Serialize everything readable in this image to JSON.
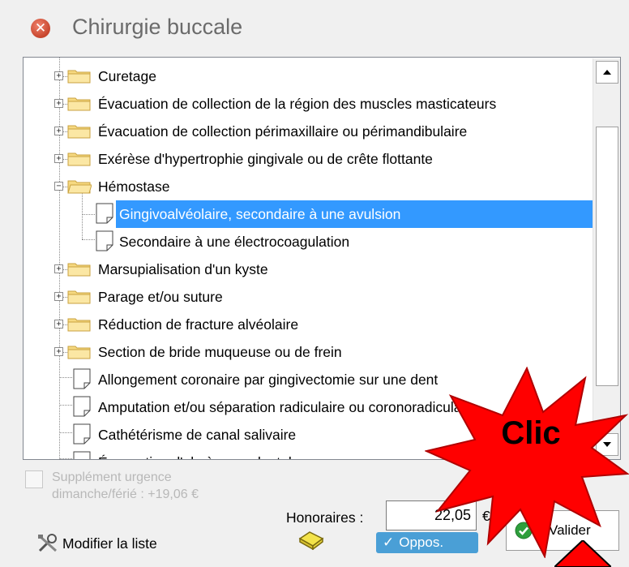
{
  "window": {
    "title": "Chirurgie buccale"
  },
  "tree": {
    "items": [
      {
        "label": "Curetage",
        "type": "folder",
        "expanded": false
      },
      {
        "label": "Évacuation de collection de la région des muscles masticateurs",
        "type": "folder",
        "expanded": false
      },
      {
        "label": "Évacuation de collection périmaxillaire ou périmandibulaire",
        "type": "folder",
        "expanded": false
      },
      {
        "label": "Exérèse d'hypertrophie gingivale ou de crête flottante",
        "type": "folder",
        "expanded": false
      },
      {
        "label": "Hémostase",
        "type": "folder",
        "expanded": true
      },
      {
        "label": "Gingivoalvéolaire, secondaire à une avulsion",
        "type": "document",
        "selected": true
      },
      {
        "label": "Secondaire à une électrocoagulation",
        "type": "document"
      },
      {
        "label": "Marsupialisation d'un kyste",
        "type": "folder",
        "expanded": false
      },
      {
        "label": "Parage et/ou suture",
        "type": "folder",
        "expanded": false
      },
      {
        "label": "Réduction de fracture alvéolaire",
        "type": "folder",
        "expanded": false
      },
      {
        "label": "Section de bride muqueuse ou de frein",
        "type": "folder",
        "expanded": false
      },
      {
        "label": "Allongement coronaire par gingivectomie sur une dent",
        "type": "document"
      },
      {
        "label": "Amputation et/ou séparation radiculaire ou coronoradiculaire",
        "type": "document"
      },
      {
        "label": "Cathétérisme de canal salivaire",
        "type": "document"
      },
      {
        "label": "Évacuation d'abcès parodontal",
        "type": "document"
      }
    ]
  },
  "supplement": {
    "label_line1": "Supplément urgence",
    "label_line2": "dimanche/férié : +19,06 €",
    "checked": false
  },
  "honoraires": {
    "label": "Honoraires :",
    "value": "22,05",
    "currency": "€"
  },
  "modify": {
    "label": "Modifier la liste"
  },
  "oppos": {
    "label": "Oppos."
  },
  "validate": {
    "label": "Valider"
  },
  "annotation": {
    "label": "Clic",
    "color": "#ff0000"
  },
  "colors": {
    "selection": "#3399ff",
    "oppos": "#4a9fd6",
    "valider_check": "#2e9e3c",
    "close": "#d9553d"
  }
}
